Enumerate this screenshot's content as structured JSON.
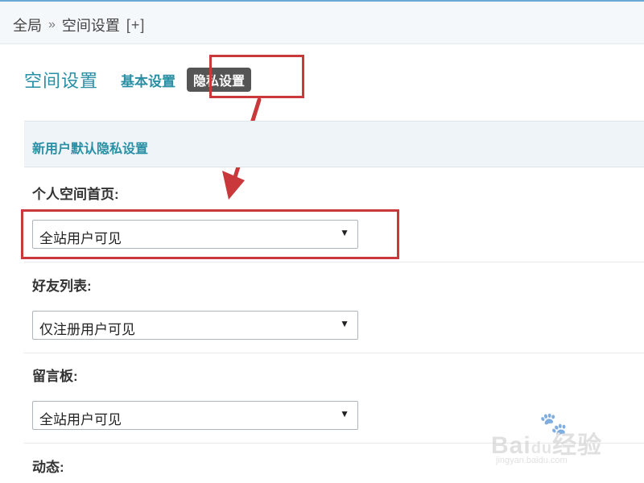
{
  "breadcrumb": {
    "root": "全局",
    "separator": "»",
    "current": "空间设置",
    "add": "[+]"
  },
  "header": {
    "title": "空间设置",
    "tabs": [
      {
        "label": "基本设置",
        "active": false
      },
      {
        "label": "隐私设置",
        "active": true
      }
    ]
  },
  "section": {
    "title": "新用户默认隐私设置"
  },
  "fields": [
    {
      "label": "个人空间首页:",
      "value": "全站用户可见"
    },
    {
      "label": "好友列表:",
      "value": "仅注册用户可见"
    },
    {
      "label": "留言板:",
      "value": "全站用户可见"
    },
    {
      "label": "动态:"
    }
  ],
  "icons": {
    "select_arrow": "▼",
    "paw": "🐾"
  },
  "watermark": {
    "logo_prefix": "Bai",
    "logo_du": "du",
    "logo_suffix": "经验",
    "url": "jingyan.baidu.com"
  },
  "colors": {
    "accent": "#2a8fa4",
    "highlight": "#c9393c",
    "active_tab_bg": "#555555"
  }
}
